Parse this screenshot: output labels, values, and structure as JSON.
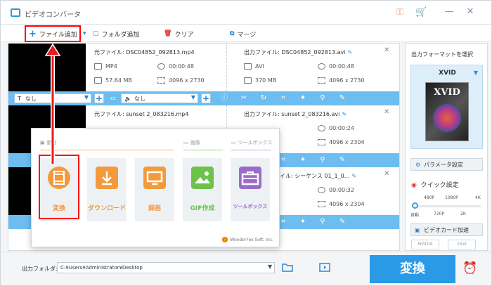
{
  "app": {
    "title": "ビデオコンバータ"
  },
  "toolbar": {
    "add_file": "ファイル追加",
    "add_folder": "フォルダ追加",
    "clear": "クリア",
    "merge": "マージ"
  },
  "files": [
    {
      "source_name": "元ファイル: DSC04852_092813.mp4",
      "output_name": "出力ファイル: DSC04852_092813.avi",
      "src_format": "MP4",
      "src_duration": "00:00:48",
      "src_size": "57.64 MB",
      "src_resolution": "4096 x 2730",
      "out_format": "AVI",
      "out_duration": "00:00:48",
      "out_size": "370 MB",
      "out_resolution": "4096 x 2730"
    },
    {
      "source_name": "元ファイル: sunset 2_083216.mp4",
      "output_name": "出力ファイル: sunset 2_083216.avi",
      "out_duration": "00:00:24",
      "out_resolution": "4096 x 2304"
    },
    {
      "output_name": "イル: シーケンス 01_1_0...",
      "out_duration": "00:00:32",
      "out_resolution": "4096 x 2304"
    }
  ],
  "edit_bar": {
    "subtitle_value": "なし",
    "audio_value": "なし"
  },
  "right_panel": {
    "title": "出力フォーマットを選択",
    "format": "XVID",
    "cover_text": "XVID",
    "param_button": "パラメータ設定",
    "quick_title": "クイック設定",
    "quick_labels_top": [
      "480P",
      "1080P",
      "4K"
    ],
    "quick_labels_bottom": [
      "自動",
      "720P",
      "2K"
    ],
    "quick_level": 0,
    "gpu_button": "ビデオカード加速",
    "gpu_badges": [
      "NVIDIA",
      "Intel"
    ]
  },
  "bottom": {
    "output_label": "出力フォルダ:",
    "output_path": "C:¥Users¥Administrator¥Desktop",
    "convert_button": "変換"
  },
  "popup": {
    "section_video": "動画",
    "section_image": "画像",
    "section_tools": "ツールボックス",
    "tiles": [
      "変換",
      "ダウンロード",
      "録画",
      "GIF作成",
      "ツールボックス"
    ],
    "brand": "WonderFox Soft, Inc."
  },
  "colors": {
    "accent": "#2b9ae6",
    "edit_bar": "#6dbdf0",
    "highlight": "#ff0000",
    "tile_convert": "#f39a3d",
    "tile_download": "#f39a3d",
    "tile_record": "#f39a3d",
    "tile_gif": "#6cc24a",
    "tile_toolbox": "#9b6bc9"
  }
}
